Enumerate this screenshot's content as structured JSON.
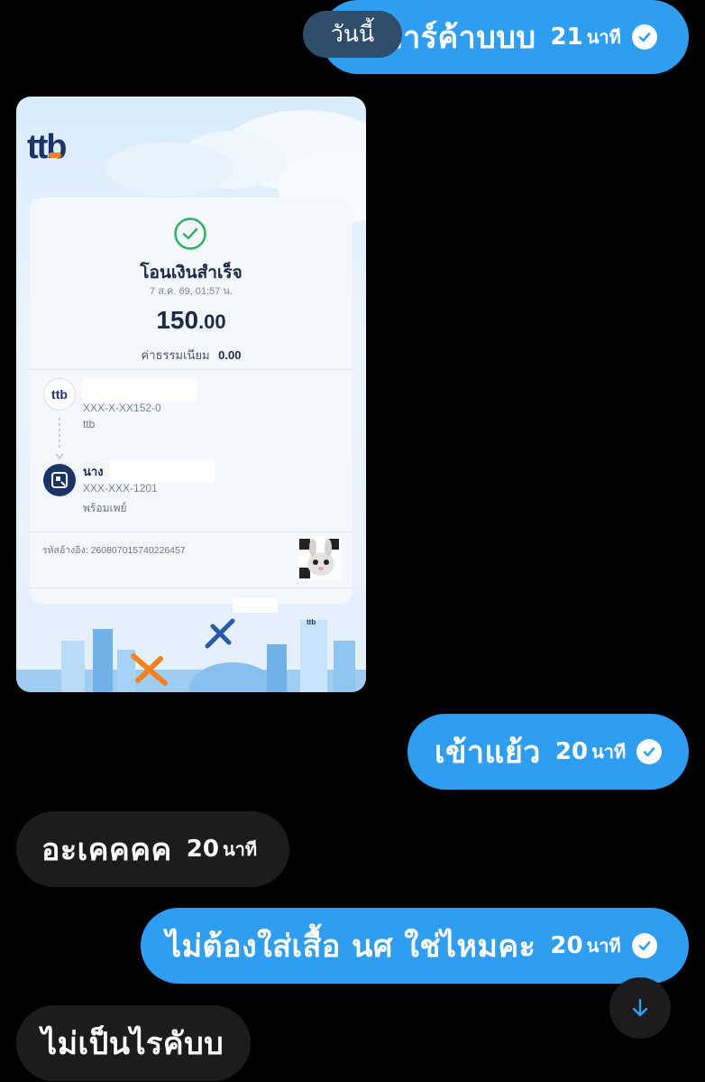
{
  "date_chip": "วันนี้",
  "messages": [
    {
      "dir": "out",
      "text": "การ์ค้าบบบ",
      "time_num": "21",
      "time_unit": "นาที",
      "read": true
    },
    {
      "dir": "out",
      "text": "เข้าแย้ว",
      "time_num": "20",
      "time_unit": "นาที",
      "read": true
    },
    {
      "dir": "in",
      "text": "อะเคคคค",
      "time_num": "20",
      "time_unit": "นาที"
    },
    {
      "dir": "out",
      "text": "ไม่ต้องใส่เสื้อ นศ ใช่ไหมคะ",
      "time_num": "20",
      "time_unit": "นาที",
      "read": true
    },
    {
      "dir": "in",
      "text": "ไม่เป็นไรคับบ"
    }
  ],
  "receipt": {
    "bank_logo": "ttb",
    "status": "โอนเงินสำเร็จ",
    "datetime": "7 ส.ค. 69, 01:57 น.",
    "amount_main": "150",
    "amount_dec": ".00",
    "fee_label": "ค่าธรรมเนียม",
    "fee_value": "0.00",
    "sender": {
      "account": "XXX-X-XX152-0",
      "bank": "ttb",
      "icon": "ttb-logo-icon"
    },
    "receiver": {
      "name_prefix": "นาง",
      "account": "XXX-XXX-1201",
      "bank": "พร้อมเพย์",
      "icon": "promptpay-icon"
    },
    "ref_label": "รหัสอ้างอิง:",
    "ref_value": "260807015740226457",
    "building_sign": "ttb"
  },
  "colors": {
    "outgoing": "#2f9ef0",
    "incoming": "#1c1c1e",
    "success": "#2bb25a",
    "brand_navy": "#1b3468",
    "brand_orange": "#f58220"
  }
}
